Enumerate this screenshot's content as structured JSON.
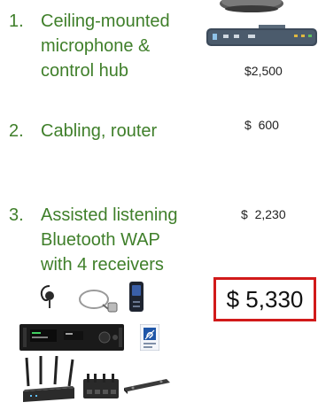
{
  "items": [
    {
      "number": "1.",
      "lines": [
        "Ceiling-mounted",
        "microphone &",
        "control hub"
      ],
      "price": "$2,500"
    },
    {
      "number": "2.",
      "lines": [
        "Cabling, router"
      ],
      "price": "$  600"
    },
    {
      "number": "3.",
      "lines": [
        "Assisted listening",
        "Bluetooth WAP",
        "with 4 receivers"
      ],
      "price": "$  2,230"
    }
  ],
  "total": "$ 5,330",
  "colors": {
    "item_text": "#3f7f2a",
    "total_border": "#d11a1a"
  },
  "images": [
    "ceiling-microphone-image",
    "control-hub-image",
    "earpiece-image",
    "neckloop-image",
    "receiver-image",
    "wap-transmitter-image",
    "hearing-loop-sign-image",
    "router-image",
    "network-switch-image",
    "rack-mount-bracket-image"
  ]
}
